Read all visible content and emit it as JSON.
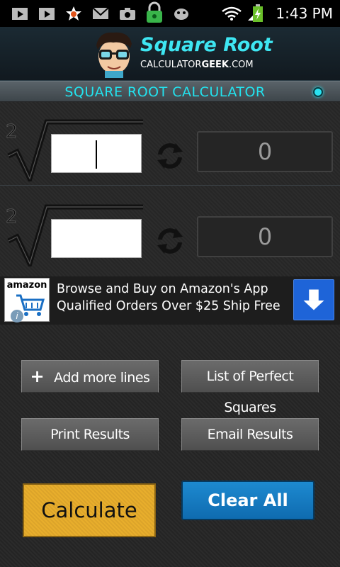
{
  "status_bar": {
    "time": "1:43 PM",
    "icons": [
      "play-store-icon",
      "play-store-icon",
      "star-notification-icon",
      "gmail-icon",
      "camera-icon",
      "lock-icon",
      "android-bug-icon",
      "wifi-icon",
      "signal-icon",
      "battery-charging-icon"
    ]
  },
  "header": {
    "logo_title": "Square Root",
    "logo_sub_left": "CALCULATOR",
    "logo_sub_bold": "GEEK",
    "logo_sub_right": ".COM"
  },
  "title_strip": {
    "text": "SQUARE ROOT CALCULATOR"
  },
  "calc_rows": [
    {
      "index": "2",
      "input_value": "",
      "result": "0",
      "focused": true
    },
    {
      "index": "2",
      "input_value": "",
      "result": "0",
      "focused": false
    }
  ],
  "ad": {
    "brand": "amazon",
    "line1": "Browse and Buy on Amazon's App",
    "line2": "Qualified Orders Over $25 Ship Free",
    "info": "i"
  },
  "buttons": {
    "add_more_lines": "Add more lines",
    "add_plus": "+",
    "list_perfect_squares": "List of Perfect Squares",
    "print_results": "Print Results",
    "email_results": "Email Results",
    "calculate": "Calculate",
    "clear_all": "Clear All"
  },
  "colors": {
    "accent_cyan": "#22e3ef",
    "calculate_orange": "#e8ae2c",
    "clear_blue": "#1278c0",
    "ad_download_blue": "#1e64d8"
  }
}
